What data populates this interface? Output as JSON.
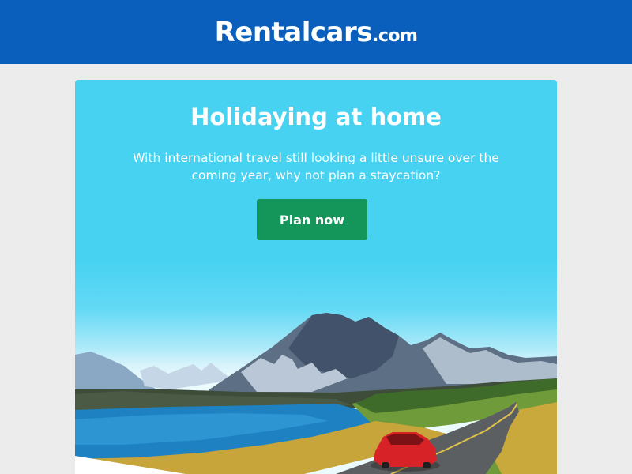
{
  "header": {
    "logo_main": "Rentalcars",
    "logo_tld": ".com",
    "bg_color": "#0b5fbc"
  },
  "hero": {
    "title": "Holidaying at home",
    "subtitle": "With international travel still looking a little unsure over the coming year, why not plan a staycation?",
    "cta_label": "Plan now",
    "bg_color": "#48d2f2",
    "cta_color": "#14965a"
  },
  "illustration": {
    "icons": [
      "mountain-range",
      "lake",
      "road",
      "car"
    ]
  }
}
